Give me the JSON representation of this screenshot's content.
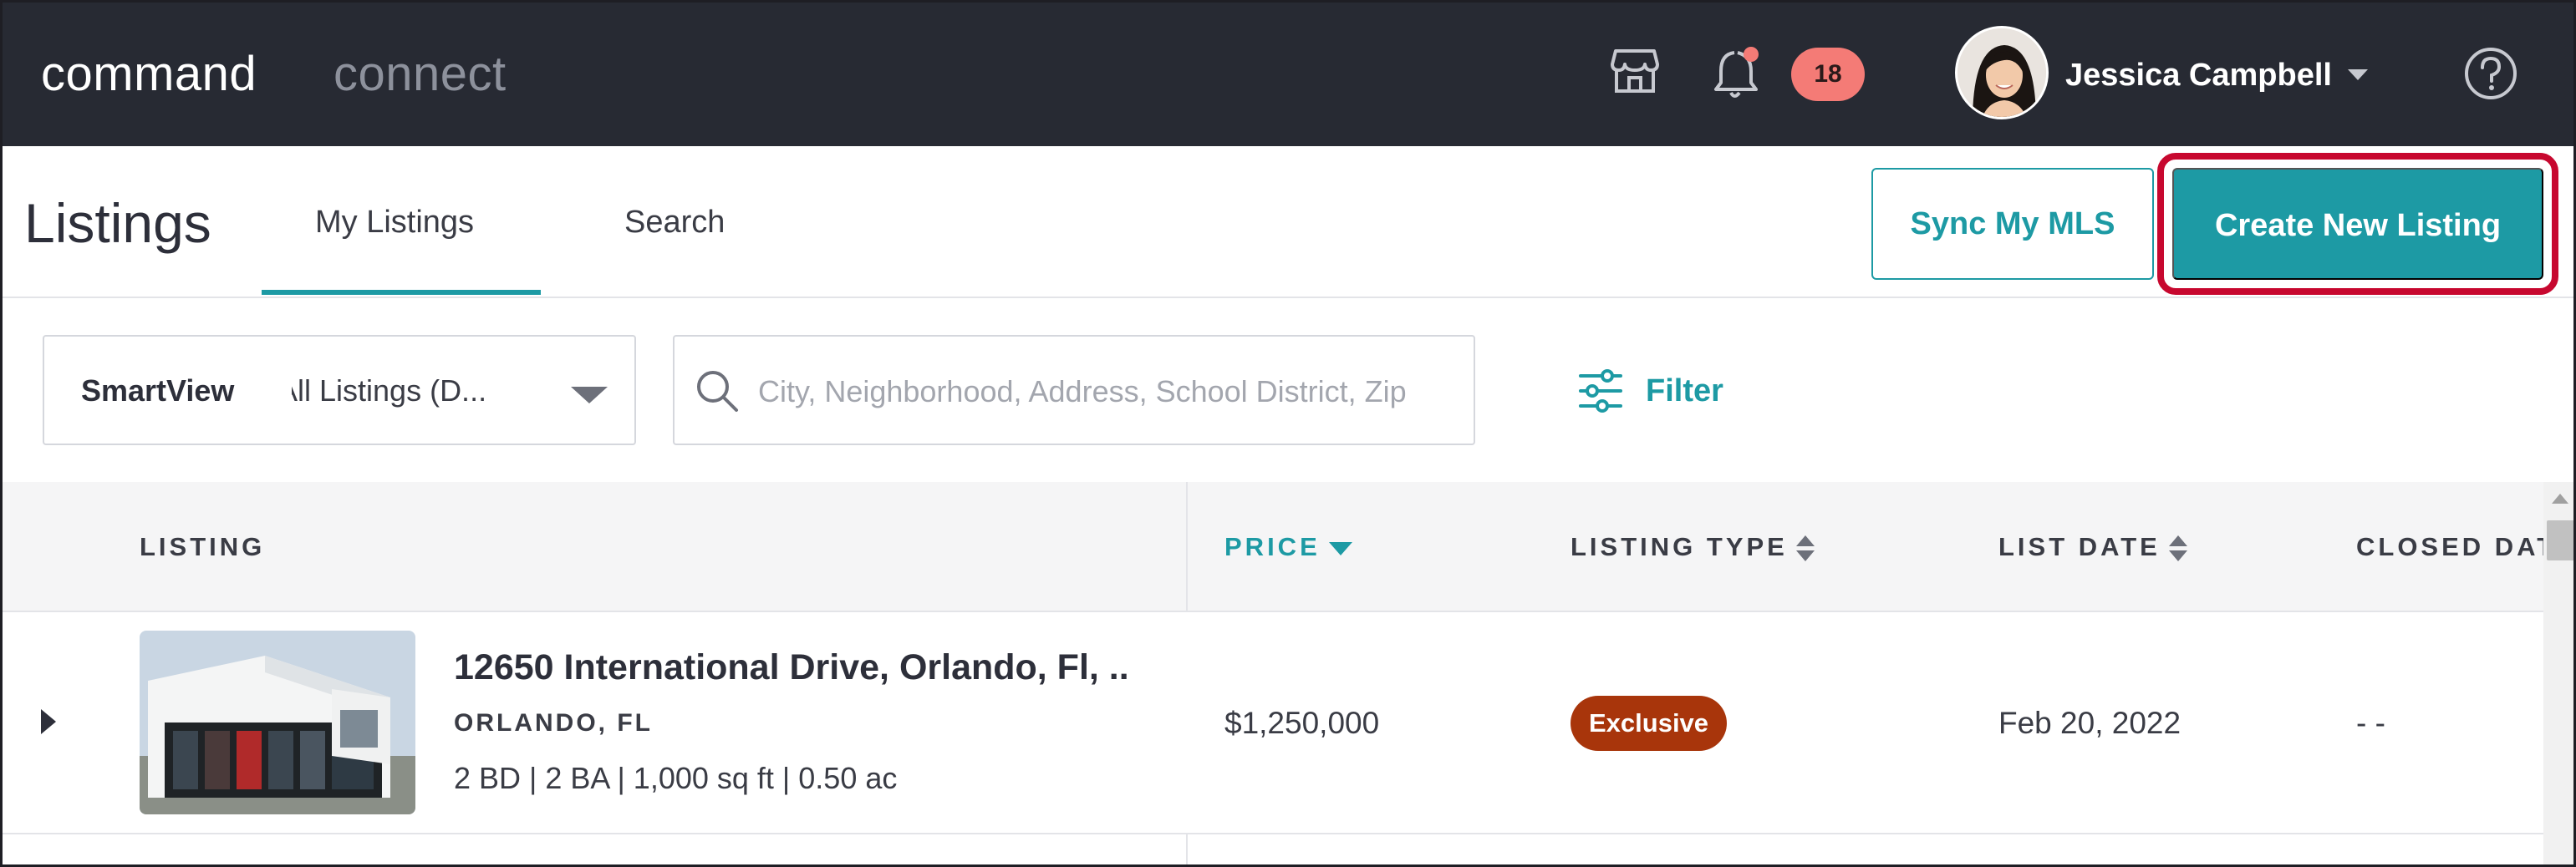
{
  "brand": {
    "primary": "command",
    "secondary": "connect"
  },
  "topbar": {
    "notifications_count": "18",
    "user_name": "Jessica Campbell",
    "icons": [
      "store-icon",
      "bell-icon",
      "avatar",
      "chevron-down-icon",
      "help-icon"
    ]
  },
  "page": {
    "title": "Listings",
    "tabs": [
      {
        "label": "My Listings",
        "active": true
      },
      {
        "label": "Search",
        "active": false
      }
    ],
    "sync_button": "Sync My MLS",
    "create_button": "Create New Listing"
  },
  "filters": {
    "smartview_label": "SmartView",
    "smartview_value": "All Listings (D...",
    "search_placeholder": "City, Neighborhood, Address, School District, Zip",
    "filter_label": "Filter"
  },
  "table": {
    "headers": {
      "listing": "LISTING",
      "price": "PRICE",
      "listing_type": "LISTING TYPE",
      "list_date": "LIST DATE",
      "closed_date": "CLOSED DATE"
    },
    "rows": [
      {
        "address": "12650 International Drive, Orlando, Fl, ..",
        "city": "ORLANDO, FL",
        "specs": "2 BD | 2 BA | 1,000 sq ft | 0.50 ac",
        "price": "$1,250,000",
        "listing_type": "Exclusive",
        "list_date": "Feb 20, 2022",
        "closed_date": "- -"
      }
    ]
  },
  "colors": {
    "accent": "#1d9aa4",
    "topbar": "#272a33",
    "badge": "#f47b76",
    "exclusive": "#a8350b",
    "highlight": "#c7082f"
  }
}
